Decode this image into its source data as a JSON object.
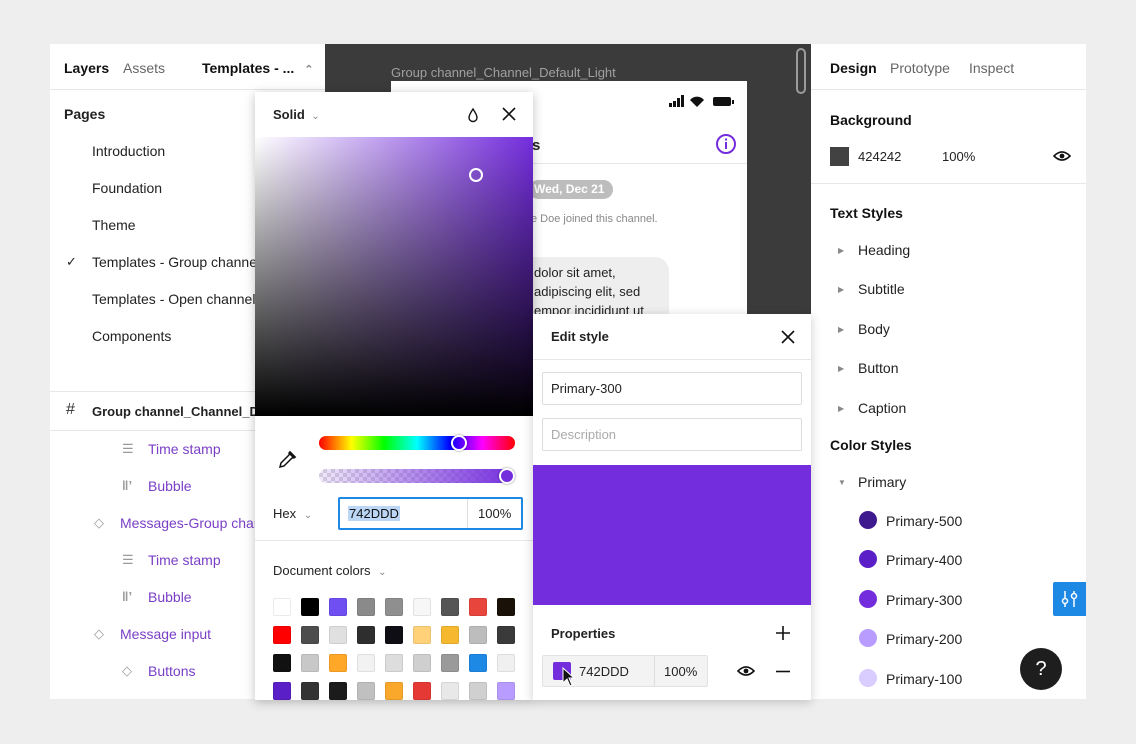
{
  "left_panel": {
    "tabs": [
      "Layers",
      "Assets"
    ],
    "page_selector": "Templates - ...",
    "pages_title": "Pages",
    "pages": [
      {
        "label": "Introduction",
        "checked": false
      },
      {
        "label": "Foundation",
        "checked": false
      },
      {
        "label": "Theme",
        "checked": false
      },
      {
        "label": "Templates - Group channel",
        "checked": true
      },
      {
        "label": "Templates - Open channel",
        "checked": false
      },
      {
        "label": "Components",
        "checked": false
      }
    ],
    "layers": {
      "root": "Group channel_Channel_Default_Light",
      "items": [
        {
          "label": "Time stamp",
          "icon": "text-icon",
          "indent": 2
        },
        {
          "label": "Bubble",
          "icon": "columns-icon",
          "indent": 2
        },
        {
          "label": "Messages-Group channel",
          "icon": "component-icon",
          "indent": 1
        },
        {
          "label": "Time stamp",
          "icon": "text-icon",
          "indent": 2
        },
        {
          "label": "Bubble",
          "icon": "columns-icon",
          "indent": 2
        },
        {
          "label": "Message input",
          "icon": "component-icon",
          "indent": 1
        },
        {
          "label": "Buttons",
          "icon": "component-icon",
          "indent": 2
        }
      ]
    }
  },
  "canvas": {
    "frame_label": "Group channel_Channel_Default_Light",
    "date_chip": "Wed, Dec 21",
    "join_text": "e Doe joined this channel.",
    "title_fragment": "s",
    "message_lines": [
      "dolor sit amet,",
      "adipiscing elit, sed",
      "empor incididunt ut"
    ]
  },
  "picker": {
    "mode": "Solid",
    "hex_label": "Hex",
    "hex_value": "742DDD",
    "opacity": "100%",
    "document_colors_title": "Document colors",
    "document_colors": [
      "#ffffff",
      "#000000",
      "#6f4ef2",
      "#8a8a8a",
      "#8f8f8f",
      "#f7f7f7",
      "#555555",
      "#e8453c",
      "#1a1208",
      "#ff0000",
      "#4d4d4d",
      "#e0e0e0",
      "#2e2e2e",
      "#0e0e14",
      "#ffd27a",
      "#f5b82e",
      "#bdbdbd",
      "#3a3a3a",
      "#111111",
      "#c8c8c8",
      "#ffa726",
      "#f2f2f2",
      "#dddddd",
      "#cfcfcf",
      "#9a9a9a",
      "#1e88e5",
      "#f0f0f0",
      "#5b1fc7",
      "#333333",
      "#1b1b1b",
      "#c0c0c0",
      "#f9a82b",
      "#e53935",
      "#e8e8e8",
      "#d0d0d0",
      "#b99cff"
    ]
  },
  "edit_style": {
    "title": "Edit style",
    "name_value": "Primary-300",
    "description_placeholder": "Description",
    "preview_color": "#742DDD",
    "properties_title": "Properties",
    "property_hex": "742DDD",
    "property_opacity": "100%"
  },
  "right_panel": {
    "tabs": [
      "Design",
      "Prototype",
      "Inspect"
    ],
    "background_title": "Background",
    "background_hex": "424242",
    "background_opacity": "100%",
    "background_color": "#424242",
    "text_styles_title": "Text Styles",
    "text_styles": [
      "Heading",
      "Subtitle",
      "Body",
      "Button",
      "Caption"
    ],
    "color_styles_title": "Color Styles",
    "color_group": "Primary",
    "color_styles": [
      {
        "name": "Primary-500",
        "color": "#3f1a8f"
      },
      {
        "name": "Primary-400",
        "color": "#5b1fc7"
      },
      {
        "name": "Primary-300",
        "color": "#742DDD"
      },
      {
        "name": "Primary-200",
        "color": "#b99cff"
      },
      {
        "name": "Primary-100",
        "color": "#d9ccff"
      }
    ]
  },
  "help_label": "?"
}
